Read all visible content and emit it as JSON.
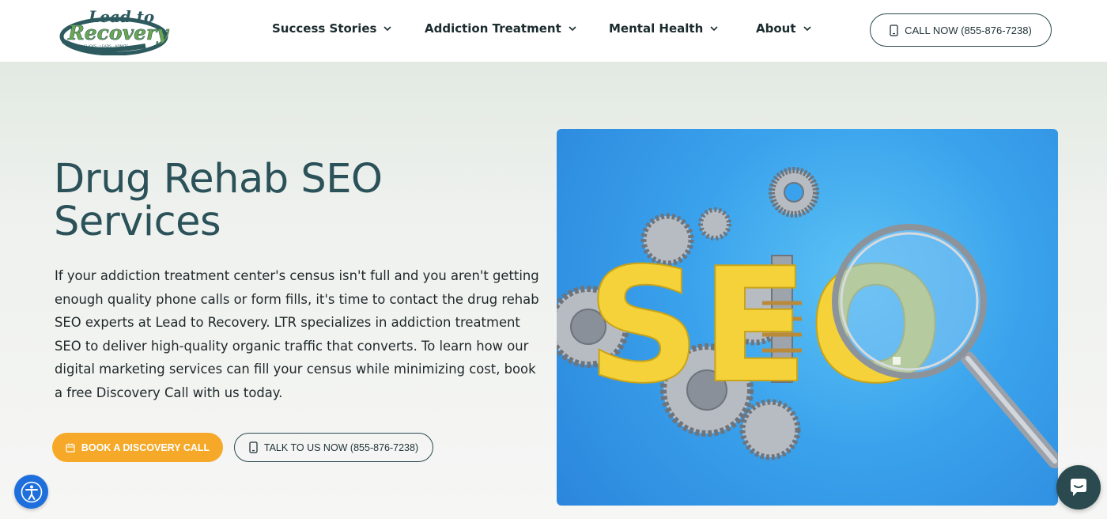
{
  "header": {
    "logo": {
      "line1": "Lead to",
      "line2": "Recovery",
      "tagline": "CLICKS · LEADS · ADMITS"
    },
    "nav": [
      {
        "label": "Success Stories"
      },
      {
        "label": "Addiction Treatment"
      },
      {
        "label": "Mental Health"
      },
      {
        "label": "About"
      }
    ],
    "call_button": "CALL NOW (855-876-7238)"
  },
  "hero": {
    "title_line1": "Drug Rehab SEO",
    "title_line2": "Services",
    "description": "If your addiction treatment center's census isn't full and you aren't getting enough quality phone calls or form fills, it's time to contact the drug rehab SEO experts at Lead to Recovery. LTR specializes in addiction treatment SEO to deliver high-quality organic traffic that converts. To learn how our digital marketing services can fill your census while minimizing cost, book a free Discovery Call with us today.",
    "book_button": "BOOK A DISCOVERY CALL",
    "talk_button": "TALK TO US NOW (855-876-7238)",
    "image_text": "SEO"
  },
  "widgets": {
    "accessibility_icon": "accessibility-icon",
    "chat_icon": "chat-bubble-icon"
  },
  "colors": {
    "title": "#2b5159",
    "accent_orange": "#f6a929",
    "outline": "#2a4a4f",
    "image_bg": "#3aa2ec",
    "seo_yellow": "#f5d23a"
  }
}
